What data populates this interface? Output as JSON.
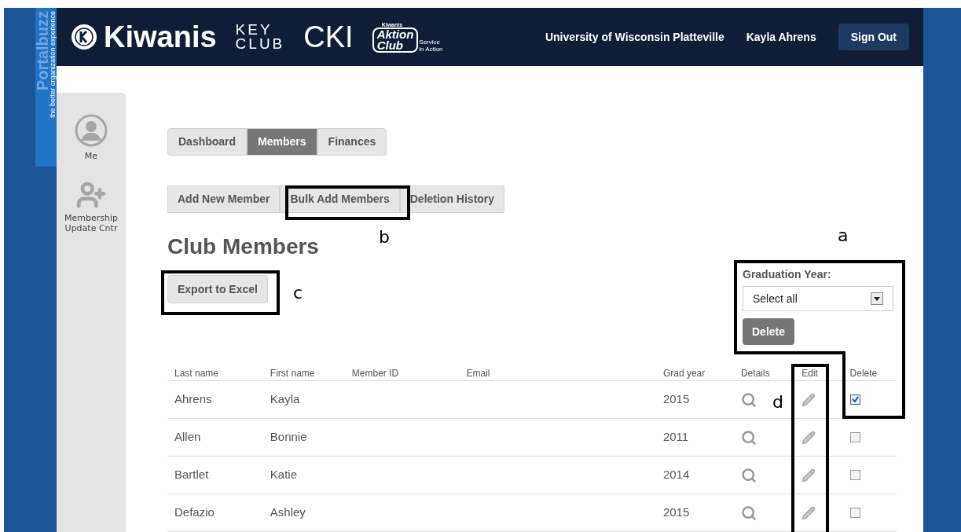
{
  "brand_tab": {
    "title": "Portalbuzz",
    "tagline": "the better organization experience"
  },
  "header": {
    "logos": [
      {
        "kind": "kiwanis",
        "text": "Kiwanis"
      },
      {
        "kind": "keyclub",
        "lines": [
          "KEY",
          "CLUB"
        ]
      },
      {
        "kind": "cki",
        "text": "CKI"
      },
      {
        "kind": "aktion",
        "top": "Kiwanis",
        "lines": [
          "Aktion",
          "Club"
        ],
        "tag": [
          "Service",
          "in Action"
        ]
      }
    ],
    "club": "University of Wisconsin Platteville",
    "user": "Kayla Ahrens",
    "sign_out": "Sign Out"
  },
  "sidebar": {
    "items": [
      {
        "kind": "me",
        "label": "Me"
      },
      {
        "kind": "update",
        "label": "Membership Update Cntr"
      }
    ]
  },
  "tabs": [
    {
      "label": "Dashboard",
      "selected": false
    },
    {
      "label": "Members",
      "selected": true
    },
    {
      "label": "Finances",
      "selected": false
    }
  ],
  "actions": [
    "Add New Member",
    "Bulk Add Members",
    "Deletion History"
  ],
  "title": "Club Members",
  "export": "Export to Excel",
  "filter": {
    "label": "Graduation Year:",
    "value": "Select all",
    "button": "Delete"
  },
  "table": {
    "columns": [
      "Last name",
      "First name",
      "Member ID",
      "Email",
      "Grad year",
      "Details",
      "Edit",
      "Delete"
    ],
    "rows": [
      {
        "last": "Ahrens",
        "first": "Kayla",
        "year": "2015",
        "checked": true
      },
      {
        "last": "Allen",
        "first": "Bonnie",
        "year": "2011",
        "checked": false
      },
      {
        "last": "Bartlet",
        "first": "Katie",
        "year": "2014",
        "checked": false
      },
      {
        "last": "Defazio",
        "first": "Ashley",
        "year": "2015",
        "checked": false
      }
    ]
  },
  "annotations": [
    "a",
    "b",
    "c",
    "d"
  ]
}
